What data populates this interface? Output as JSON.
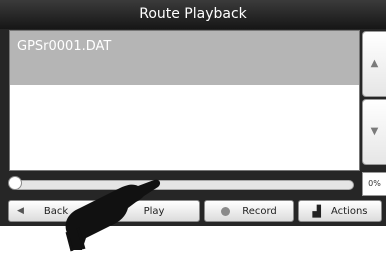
{
  "title": "Route Playback",
  "files": [
    {
      "name": "GPSr0001.DAT",
      "selected": true
    }
  ],
  "scroll": {
    "up_icon": "triangle-up",
    "down_icon": "triangle-down"
  },
  "playback": {
    "progress_percent": 0,
    "progress_label": "0%"
  },
  "buttons": {
    "back": {
      "label": "Back",
      "icon": "triangle-left"
    },
    "play": {
      "label": "Play"
    },
    "record": {
      "label": "Record",
      "icon": "record-dot"
    },
    "actions": {
      "label": "Actions",
      "icon": "actions-icon"
    }
  },
  "colors": {
    "title_bar": "#262626",
    "selected_row": "#b5b5b5",
    "record_dot": "#8a8a8a"
  }
}
